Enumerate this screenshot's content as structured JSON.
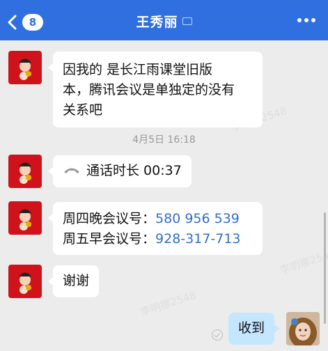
{
  "header": {
    "back_badge": "8",
    "title": "王秀丽"
  },
  "watermark": "李明娜2548",
  "messages": [
    {
      "lines": [
        "因我的 是长江雨课堂旧版",
        "本，腾讯会议是单独定的没有",
        "关系吧"
      ]
    },
    {
      "call_text": "通话时长 00:37"
    },
    {
      "line1_label": "周四晚会议号：",
      "line1_link": "580 956 539",
      "line2_label": "周五早会议号：",
      "line2_link": "928-317-713"
    },
    {
      "text": "谢谢"
    },
    {
      "text": "收到"
    }
  ],
  "timestamp": "4月5日 16:18",
  "icons": {
    "back": "chevron-left-icon",
    "more": "more-dots-icon",
    "call": "phone-icon",
    "read": "read-check-icon"
  },
  "colors": {
    "header": "#2f6fe0",
    "bubble_other": "#ffffff",
    "bubble_mine": "#c5e6ff",
    "link": "#2f6fc9",
    "avatar": "#d0121b"
  }
}
